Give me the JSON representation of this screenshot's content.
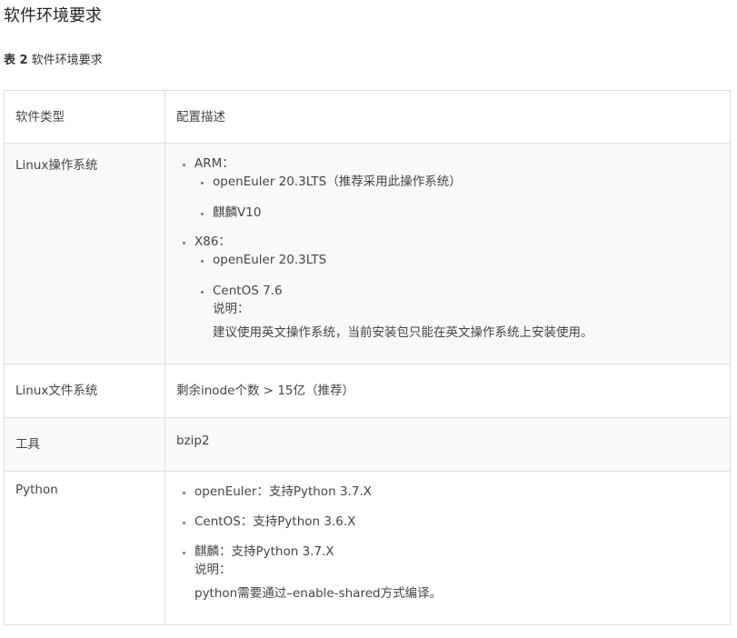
{
  "page": {
    "title": "软件环境要求"
  },
  "caption": {
    "number": "表 2",
    "text": "软件环境要求"
  },
  "table": {
    "headers": [
      "软件类型",
      "配置描述"
    ],
    "os": {
      "label": "Linux操作系统",
      "arm": {
        "label": "ARM：",
        "items": [
          "openEuler 20.3LTS（推荐采用此操作系统）",
          "麒麟V10"
        ]
      },
      "x86": {
        "label": "X86：",
        "items": [
          "openEuler 20.3LTS",
          "CentOS 7.6"
        ],
        "note_label": "说明：",
        "note_text": "建议使用英文操作系统，当前安装包只能在英文操作系统上安装使用。"
      }
    },
    "fs": {
      "label": "Linux文件系统",
      "value": "剩余inode个数 > 15亿（推荐）"
    },
    "tool": {
      "label": "工具",
      "value": "bzip2"
    },
    "python": {
      "label": "Python",
      "items": [
        "openEuler：支持Python 3.7.X",
        "CentOS：支持Python 3.6.X",
        "麒麟：支持Python 3.7.X"
      ],
      "note_label": "说明：",
      "note_text": "python需要通过–enable-shared方式编译。"
    }
  }
}
